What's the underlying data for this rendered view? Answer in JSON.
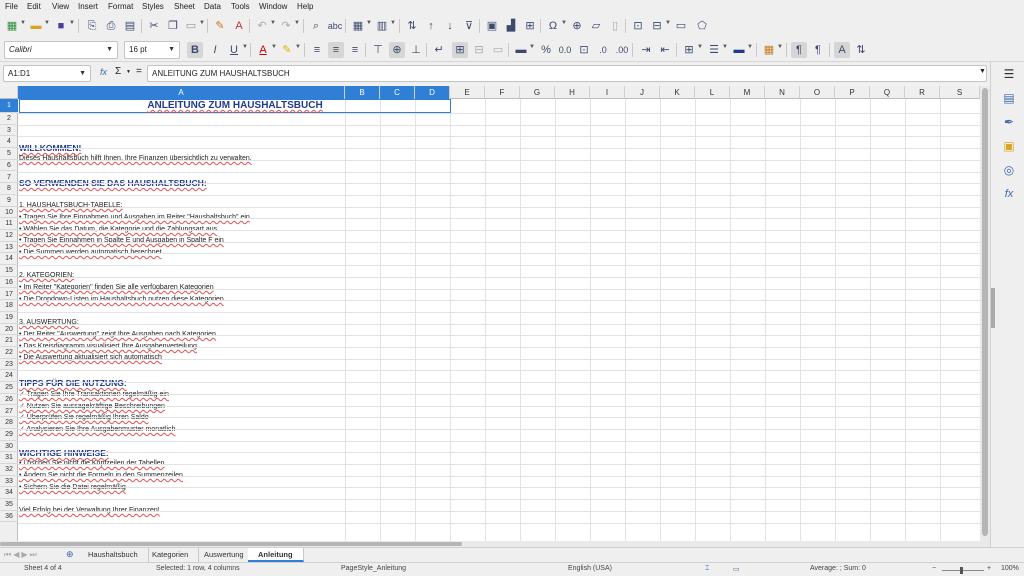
{
  "menu": [
    "File",
    "Edit",
    "View",
    "Insert",
    "Format",
    "Styles",
    "Sheet",
    "Data",
    "Tools",
    "Window",
    "Help"
  ],
  "font": {
    "name": "Calibri",
    "size": "16 pt"
  },
  "formula_bar": {
    "name_box": "A1:D1",
    "content": "ANLEITUNG ZUM HAUSHALTSBUCH",
    "sum_symbol": "Σ",
    "fx_symbol": "fx",
    "equals": "="
  },
  "columns": [
    "A",
    "B",
    "C",
    "D",
    "E",
    "F",
    "G",
    "H",
    "I",
    "J",
    "K",
    "L",
    "M",
    "N",
    "O",
    "P",
    "Q",
    "R",
    "S"
  ],
  "rows": [
    "1",
    "2",
    "3",
    "4",
    "5",
    "6",
    "7",
    "8",
    "9",
    "10",
    "11",
    "12",
    "13",
    "14",
    "15",
    "16",
    "17",
    "18",
    "19",
    "20",
    "21",
    "22",
    "23",
    "24",
    "25",
    "26",
    "27",
    "28",
    "29",
    "30",
    "31",
    "32",
    "33",
    "34",
    "35",
    "36"
  ],
  "cells": {
    "r1": "ANLEITUNG ZUM HAUSHALTSBUCH",
    "r4": "WILLKOMMEN!",
    "r5": "Dieses Haushaltsbuch hilft Ihnen, Ihre Finanzen übersichtlich zu verwalten.",
    "r7": "SO VERWENDEN SIE DAS HAUSHALTSBUCH:",
    "r9": "1. HAUSHALTSBUCH-TABELLE:",
    "r10": "  • Tragen Sie Ihre Einnahmen und Ausgaben im Reiter \"Haushaltsbuch\" ein",
    "r11": "  • Wählen Sie das Datum, die Kategorie und die Zahlungsart aus",
    "r12": "  • Tragen Sie Einnahmen in Spalte E und Ausgaben in Spalte F ein",
    "r13": "  • Die Summen werden automatisch berechnet",
    "r15": "2. KATEGORIEN:",
    "r16": "  • Im Reiter \"Kategorien\" finden Sie alle verfügbaren Kategorien",
    "r17": "  • Die Dropdown-Listen im Haushaltsbuch nutzen diese Kategorien",
    "r19": "3. AUSWERTUNG:",
    "r20": "  • Der Reiter \"Auswertung\" zeigt Ihre Ausgaben nach Kategorien",
    "r21": "  • Das Kreisdiagramm visualisiert Ihre Ausgabenverteilung",
    "r22": "  • Die Auswertung aktualisiert sich automatisch",
    "r24": "TIPPS FÜR DIE NUTZUNG:",
    "r25": "  ✓ Tragen Sie Ihre Transaktionen regelmäßig ein",
    "r26": "  ✓ Nutzen Sie aussagekräftige Beschreibungen",
    "r27": "  ✓ Überprüfen Sie regelmäßig Ihren Saldo",
    "r28": "  ✓ Analysieren Sie Ihre Ausgabenmuster monatlich",
    "r30": "WICHTIGE HINWEISE:",
    "r31": "  • Löschen Sie nicht die Kopfzeilen der Tabellen",
    "r32": "  • Ändern Sie nicht die Formeln in den Summenzeilen",
    "r33": "  • Sichern Sie die Datei regelmäßig",
    "r35": "Viel Erfolg bei der Verwaltung Ihrer Finanzen!"
  },
  "tabs": [
    "Haushaltsbuch",
    "Kategorien",
    "Auswertung",
    "Anleitung"
  ],
  "active_tab": "Anleitung",
  "status": {
    "sheet": "Sheet 4 of 4",
    "selection": "Selected: 1 row, 4 columns",
    "page_style": "PageStyle_Anleitung",
    "language": "English (USA)",
    "stats": "Average: ; Sum: 0",
    "zoom": "100%"
  },
  "colors": {
    "selection": "#2f7fd6",
    "heading": "#1f3b8c",
    "spell": "#e05050"
  }
}
